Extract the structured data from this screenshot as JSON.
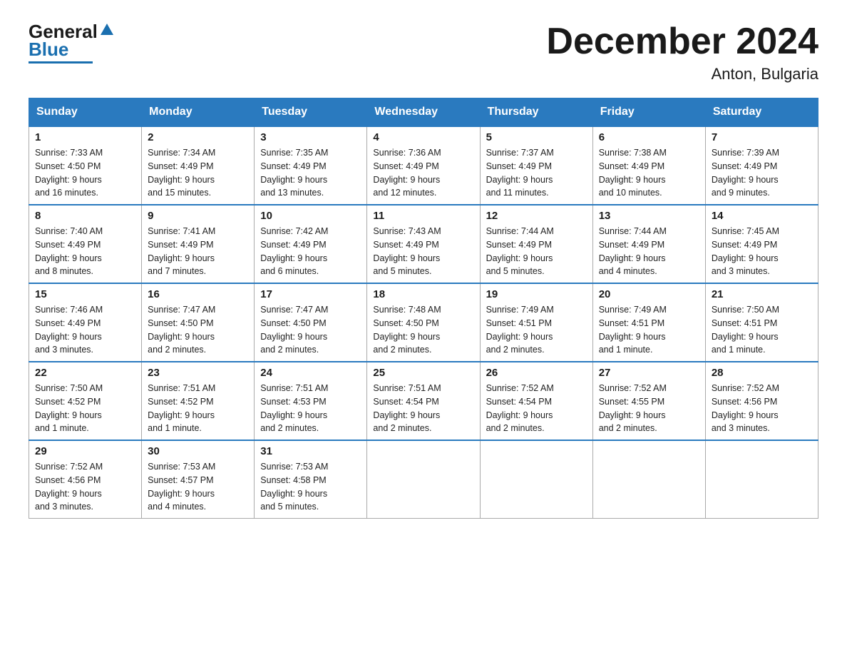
{
  "header": {
    "logo_general": "General",
    "logo_blue": "Blue",
    "main_title": "December 2024",
    "subtitle": "Anton, Bulgaria"
  },
  "days_of_week": [
    "Sunday",
    "Monday",
    "Tuesday",
    "Wednesday",
    "Thursday",
    "Friday",
    "Saturday"
  ],
  "weeks": [
    [
      {
        "day": "1",
        "sunrise": "7:33 AM",
        "sunset": "4:50 PM",
        "daylight": "9 hours and 16 minutes."
      },
      {
        "day": "2",
        "sunrise": "7:34 AM",
        "sunset": "4:49 PM",
        "daylight": "9 hours and 15 minutes."
      },
      {
        "day": "3",
        "sunrise": "7:35 AM",
        "sunset": "4:49 PM",
        "daylight": "9 hours and 13 minutes."
      },
      {
        "day": "4",
        "sunrise": "7:36 AM",
        "sunset": "4:49 PM",
        "daylight": "9 hours and 12 minutes."
      },
      {
        "day": "5",
        "sunrise": "7:37 AM",
        "sunset": "4:49 PM",
        "daylight": "9 hours and 11 minutes."
      },
      {
        "day": "6",
        "sunrise": "7:38 AM",
        "sunset": "4:49 PM",
        "daylight": "9 hours and 10 minutes."
      },
      {
        "day": "7",
        "sunrise": "7:39 AM",
        "sunset": "4:49 PM",
        "daylight": "9 hours and 9 minutes."
      }
    ],
    [
      {
        "day": "8",
        "sunrise": "7:40 AM",
        "sunset": "4:49 PM",
        "daylight": "9 hours and 8 minutes."
      },
      {
        "day": "9",
        "sunrise": "7:41 AM",
        "sunset": "4:49 PM",
        "daylight": "9 hours and 7 minutes."
      },
      {
        "day": "10",
        "sunrise": "7:42 AM",
        "sunset": "4:49 PM",
        "daylight": "9 hours and 6 minutes."
      },
      {
        "day": "11",
        "sunrise": "7:43 AM",
        "sunset": "4:49 PM",
        "daylight": "9 hours and 5 minutes."
      },
      {
        "day": "12",
        "sunrise": "7:44 AM",
        "sunset": "4:49 PM",
        "daylight": "9 hours and 5 minutes."
      },
      {
        "day": "13",
        "sunrise": "7:44 AM",
        "sunset": "4:49 PM",
        "daylight": "9 hours and 4 minutes."
      },
      {
        "day": "14",
        "sunrise": "7:45 AM",
        "sunset": "4:49 PM",
        "daylight": "9 hours and 3 minutes."
      }
    ],
    [
      {
        "day": "15",
        "sunrise": "7:46 AM",
        "sunset": "4:49 PM",
        "daylight": "9 hours and 3 minutes."
      },
      {
        "day": "16",
        "sunrise": "7:47 AM",
        "sunset": "4:50 PM",
        "daylight": "9 hours and 2 minutes."
      },
      {
        "day": "17",
        "sunrise": "7:47 AM",
        "sunset": "4:50 PM",
        "daylight": "9 hours and 2 minutes."
      },
      {
        "day": "18",
        "sunrise": "7:48 AM",
        "sunset": "4:50 PM",
        "daylight": "9 hours and 2 minutes."
      },
      {
        "day": "19",
        "sunrise": "7:49 AM",
        "sunset": "4:51 PM",
        "daylight": "9 hours and 2 minutes."
      },
      {
        "day": "20",
        "sunrise": "7:49 AM",
        "sunset": "4:51 PM",
        "daylight": "9 hours and 1 minute."
      },
      {
        "day": "21",
        "sunrise": "7:50 AM",
        "sunset": "4:51 PM",
        "daylight": "9 hours and 1 minute."
      }
    ],
    [
      {
        "day": "22",
        "sunrise": "7:50 AM",
        "sunset": "4:52 PM",
        "daylight": "9 hours and 1 minute."
      },
      {
        "day": "23",
        "sunrise": "7:51 AM",
        "sunset": "4:52 PM",
        "daylight": "9 hours and 1 minute."
      },
      {
        "day": "24",
        "sunrise": "7:51 AM",
        "sunset": "4:53 PM",
        "daylight": "9 hours and 2 minutes."
      },
      {
        "day": "25",
        "sunrise": "7:51 AM",
        "sunset": "4:54 PM",
        "daylight": "9 hours and 2 minutes."
      },
      {
        "day": "26",
        "sunrise": "7:52 AM",
        "sunset": "4:54 PM",
        "daylight": "9 hours and 2 minutes."
      },
      {
        "day": "27",
        "sunrise": "7:52 AM",
        "sunset": "4:55 PM",
        "daylight": "9 hours and 2 minutes."
      },
      {
        "day": "28",
        "sunrise": "7:52 AM",
        "sunset": "4:56 PM",
        "daylight": "9 hours and 3 minutes."
      }
    ],
    [
      {
        "day": "29",
        "sunrise": "7:52 AM",
        "sunset": "4:56 PM",
        "daylight": "9 hours and 3 minutes."
      },
      {
        "day": "30",
        "sunrise": "7:53 AM",
        "sunset": "4:57 PM",
        "daylight": "9 hours and 4 minutes."
      },
      {
        "day": "31",
        "sunrise": "7:53 AM",
        "sunset": "4:58 PM",
        "daylight": "9 hours and 5 minutes."
      },
      null,
      null,
      null,
      null
    ]
  ],
  "labels": {
    "sunrise": "Sunrise:",
    "sunset": "Sunset:",
    "daylight": "Daylight:"
  }
}
